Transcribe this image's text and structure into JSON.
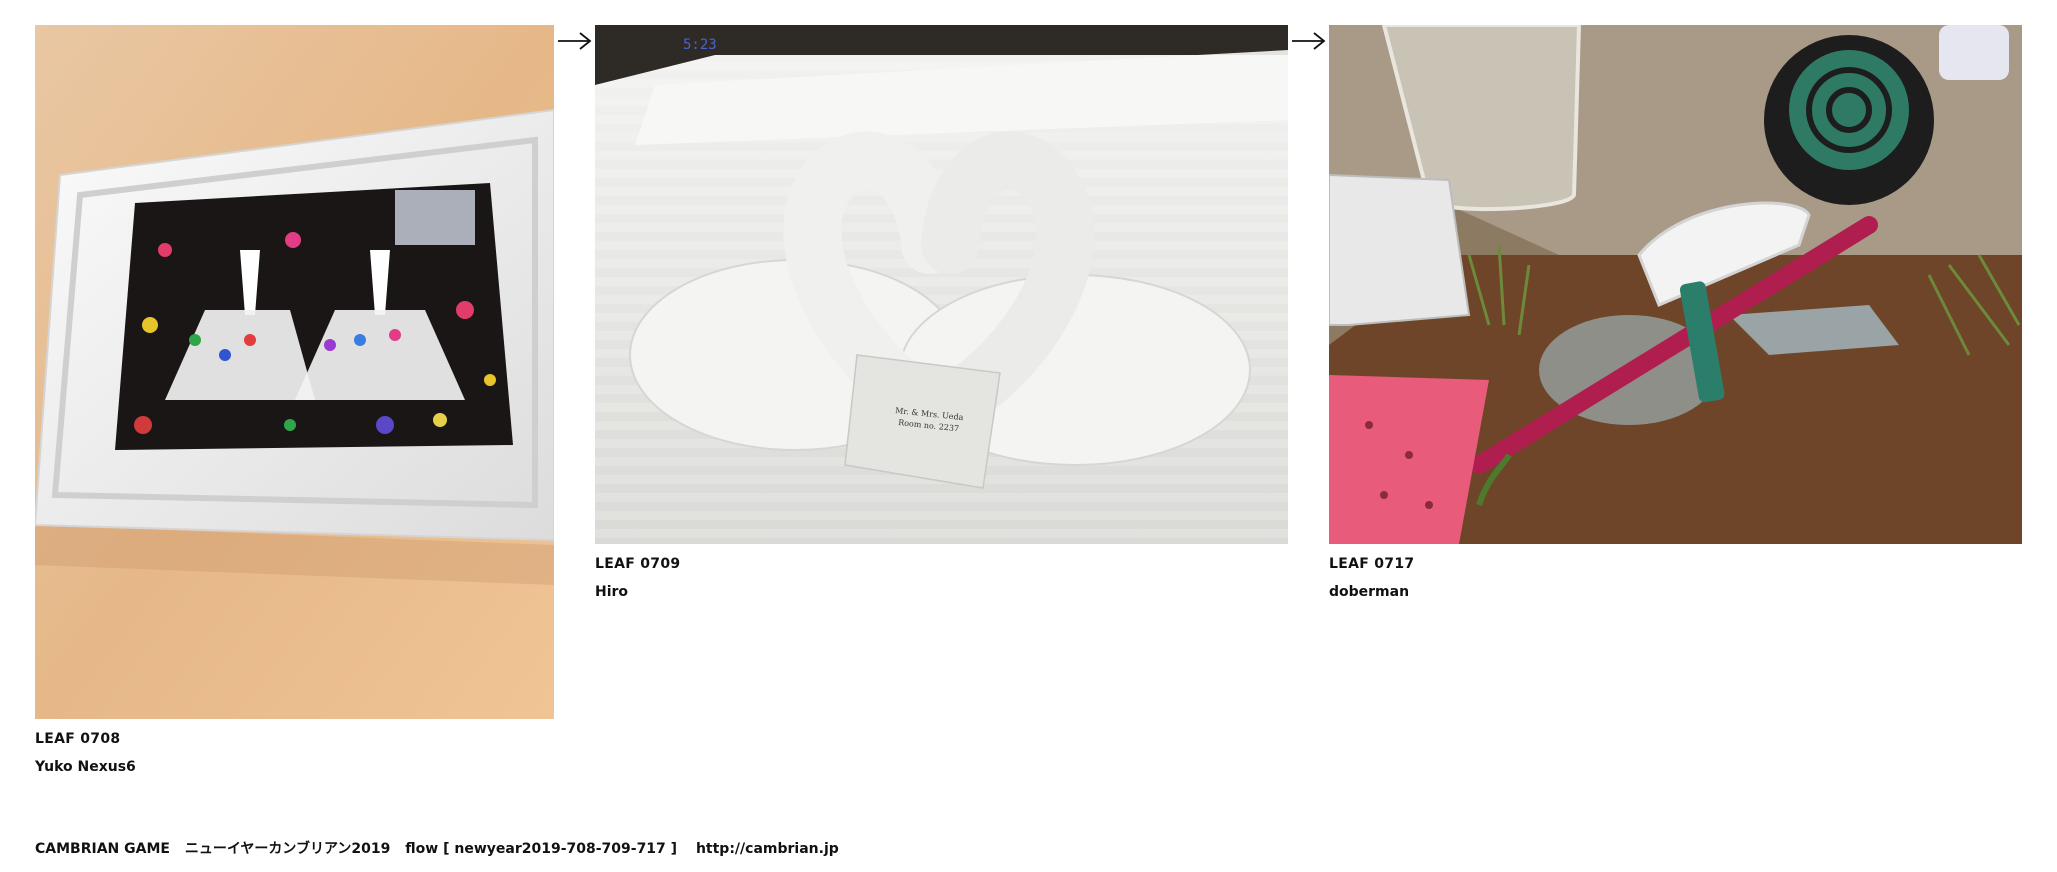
{
  "leaves": [
    {
      "id": "LEAF 0708",
      "author": "Yuko Nexus6",
      "image": "framed-ballerina-paper-art"
    },
    {
      "id": "LEAF 0709",
      "author": "Hiro",
      "image": "towel-swans-on-bed"
    },
    {
      "id": "LEAF 0717",
      "author": "doberman",
      "image": "garden-tools-on-soil"
    }
  ],
  "arrows": [
    "arrow-icon",
    "arrow-icon"
  ],
  "footer": {
    "site": "CAMBRIAN GAME",
    "title": "ニューイヤーカンブリアン2019",
    "flow": "flow [ newyear2019-708-709-717 ]",
    "url": "http://cambrian.jp"
  },
  "photo_text": {
    "card_line1": "Mr. & Mrs. Ueda",
    "card_line2": "Room no. 2237",
    "clock": "5:23"
  },
  "colors": {
    "text": "#111111",
    "wall": "#e8b98a",
    "frame": "#f2f2f2",
    "sheet": "#e7e7e5",
    "soil": "#7a5233"
  }
}
